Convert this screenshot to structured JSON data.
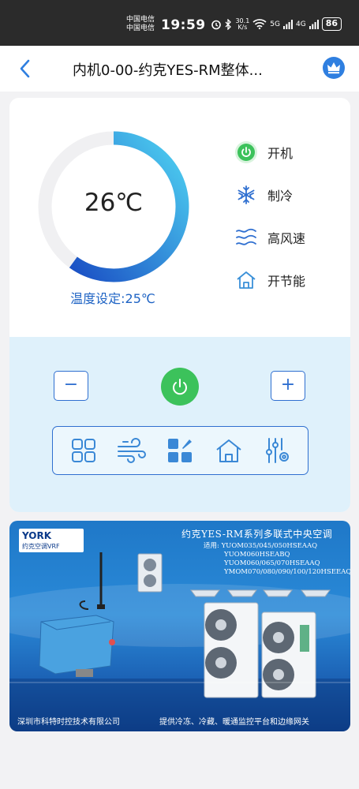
{
  "status_bar": {
    "carrier_1": "中国电信",
    "carrier_2": "中国电信",
    "time": "19:59",
    "net_speed_value": "30.1",
    "net_speed_unit": "K/s",
    "signal_1": "5G",
    "signal_2": "4G",
    "battery": "86"
  },
  "header": {
    "title": "内机0-00-约克YES-RM整体..."
  },
  "thermostat": {
    "current_temp": "26℃",
    "setpoint_label": "温度设定:25℃",
    "dial_level": 0.6,
    "colors": {
      "track": "#f0f0f2",
      "grad_start": "#1a4fc4",
      "grad_end": "#4fd3f2"
    }
  },
  "status": {
    "power": {
      "label": "开机",
      "icon": "power-icon",
      "color": "#3cc25b"
    },
    "mode": {
      "label": "制冷",
      "icon": "snowflake-icon"
    },
    "fan": {
      "label": "高风速",
      "icon": "wind-waves-icon"
    },
    "energy": {
      "label": "开节能",
      "icon": "house-icon"
    }
  },
  "controls": {
    "minus": "−",
    "plus": "+",
    "mode_buttons": [
      "grid-icon",
      "wind-icon",
      "tiles-icon",
      "house-icon",
      "sliders-icon"
    ]
  },
  "banner": {
    "logo_name": "YORK",
    "logo_sub": "约克空调VRF",
    "title": "约克YES-RM系列多联式中央空调",
    "models": [
      "适用: YUOM035/045/050HSEAAQ",
      "YUOM060HSEABQ",
      "YUOM060/065/070HSEAAQ",
      "YMOM070/080/090/100/120HSEEAQ"
    ],
    "footer_left": "深圳市科特时控技术有限公司",
    "footer_right": "提供冷冻、冷藏、暖通监控平台和边缘网关"
  },
  "accent_color": "#2f6fd0"
}
